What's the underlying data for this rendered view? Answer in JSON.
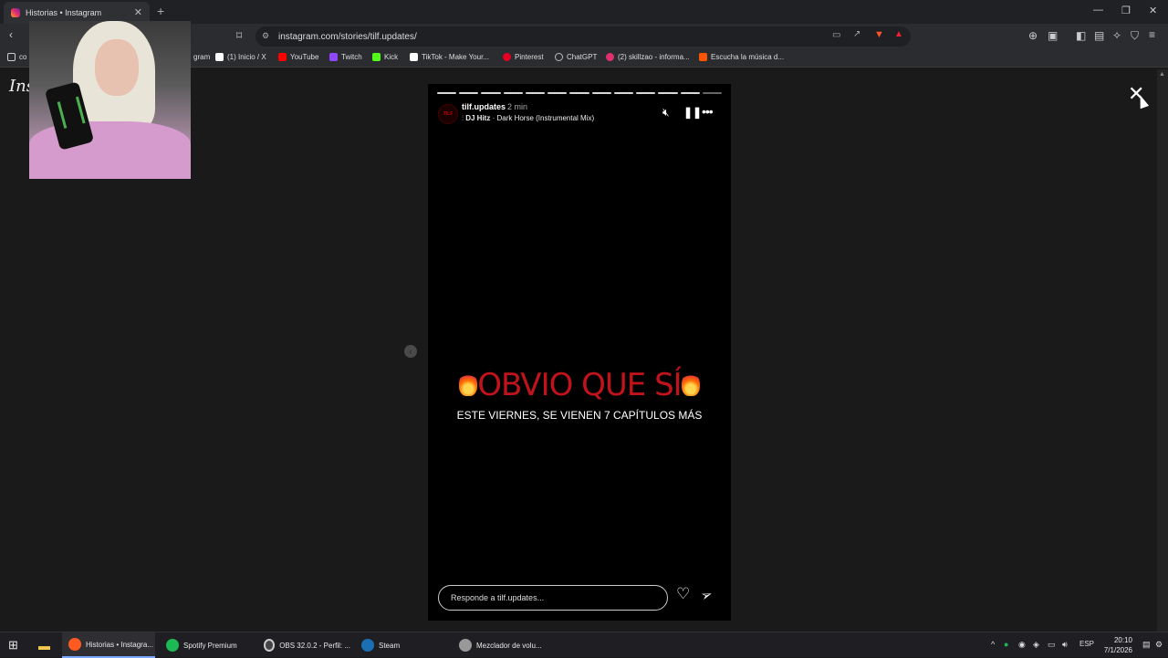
{
  "browser": {
    "tab_title": "Historias • Instagram",
    "url": "instagram.com/stories/tilf.updates/",
    "bookmarks": [
      {
        "label": "gram",
        "color": "#cccccc"
      },
      {
        "label": "(1) Inicio / X",
        "color": "#ffffff"
      },
      {
        "label": "YouTube",
        "color": "#ff0000"
      },
      {
        "label": "Twitch",
        "color": "#9146ff"
      },
      {
        "label": "Kick",
        "color": "#53fc18"
      },
      {
        "label": "TikTok - Make Your...",
        "color": "#ffffff"
      },
      {
        "label": "Pinterest",
        "color": "#e60023"
      },
      {
        "label": "ChatGPT",
        "color": "#bbbbbb"
      },
      {
        "label": "(2) skillzao - informa...",
        "color": "#e1306c"
      },
      {
        "label": "Escucha la música d...",
        "color": "#ff5500"
      }
    ],
    "bookmark_partial_left": "co"
  },
  "page": {
    "logo": "Ins"
  },
  "story": {
    "username": "tilf.updates",
    "time": "2 min",
    "avatar_text": "TILF",
    "music_artist": "DJ Hitz",
    "music_title": " · Dark Horse (Instrumental Mix)",
    "segments_total": 13,
    "segment_current": 13,
    "headline": "OBVIO QUE SÍ",
    "subtitle": "ESTE VIERNES, SE VIENEN 7 CAPÍTULOS MÁS",
    "reply_placeholder": "Responde a tilf.updates..."
  },
  "taskbar": {
    "items": [
      {
        "label": "Historias • Instagra...",
        "color": "#ff5a1f",
        "active": true
      },
      {
        "label": "Spotify Premium",
        "color": "#1db954",
        "active": false
      },
      {
        "label": "OBS 32.0.2 - Perfil: ...",
        "color": "#444444",
        "active": false
      },
      {
        "label": "Steam",
        "color": "#1b6fb5",
        "active": false
      },
      {
        "label": "Mezclador de volu...",
        "color": "#999999",
        "active": false
      }
    ],
    "lang": "ESP",
    "time": "20:10",
    "date": "7/1/2026"
  }
}
